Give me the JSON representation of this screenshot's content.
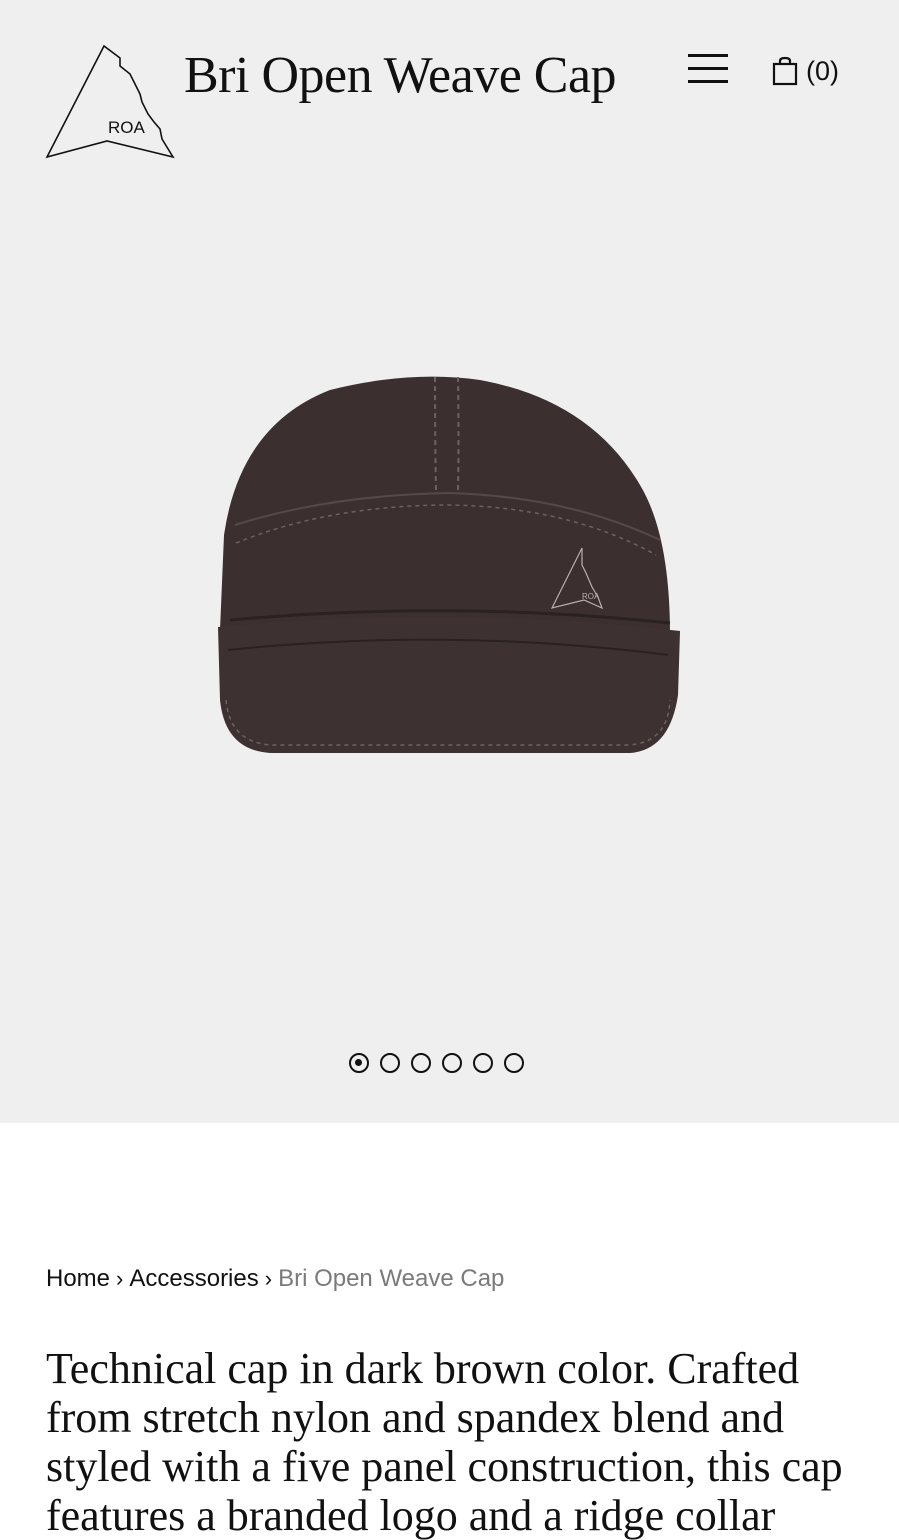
{
  "header": {
    "logo_text": "ROA",
    "title": "Bri Open Weave Cap",
    "cart_count": "(0)"
  },
  "icons": {
    "menu": "hamburger-menu-icon",
    "cart": "shopping-bag-icon"
  },
  "gallery": {
    "total_images": 6,
    "active_index": 0,
    "background": "#efefef",
    "product_color": "#3b302f"
  },
  "breadcrumb": {
    "home": "Home",
    "separator": "›",
    "category": "Accessories",
    "current": "Bri Open Weave Cap"
  },
  "description": {
    "text": "Technical cap in dark brown color. Crafted from stretch nylon and spandex blend and styled with a five panel construction, this cap features a branded logo and a ridge collar"
  }
}
